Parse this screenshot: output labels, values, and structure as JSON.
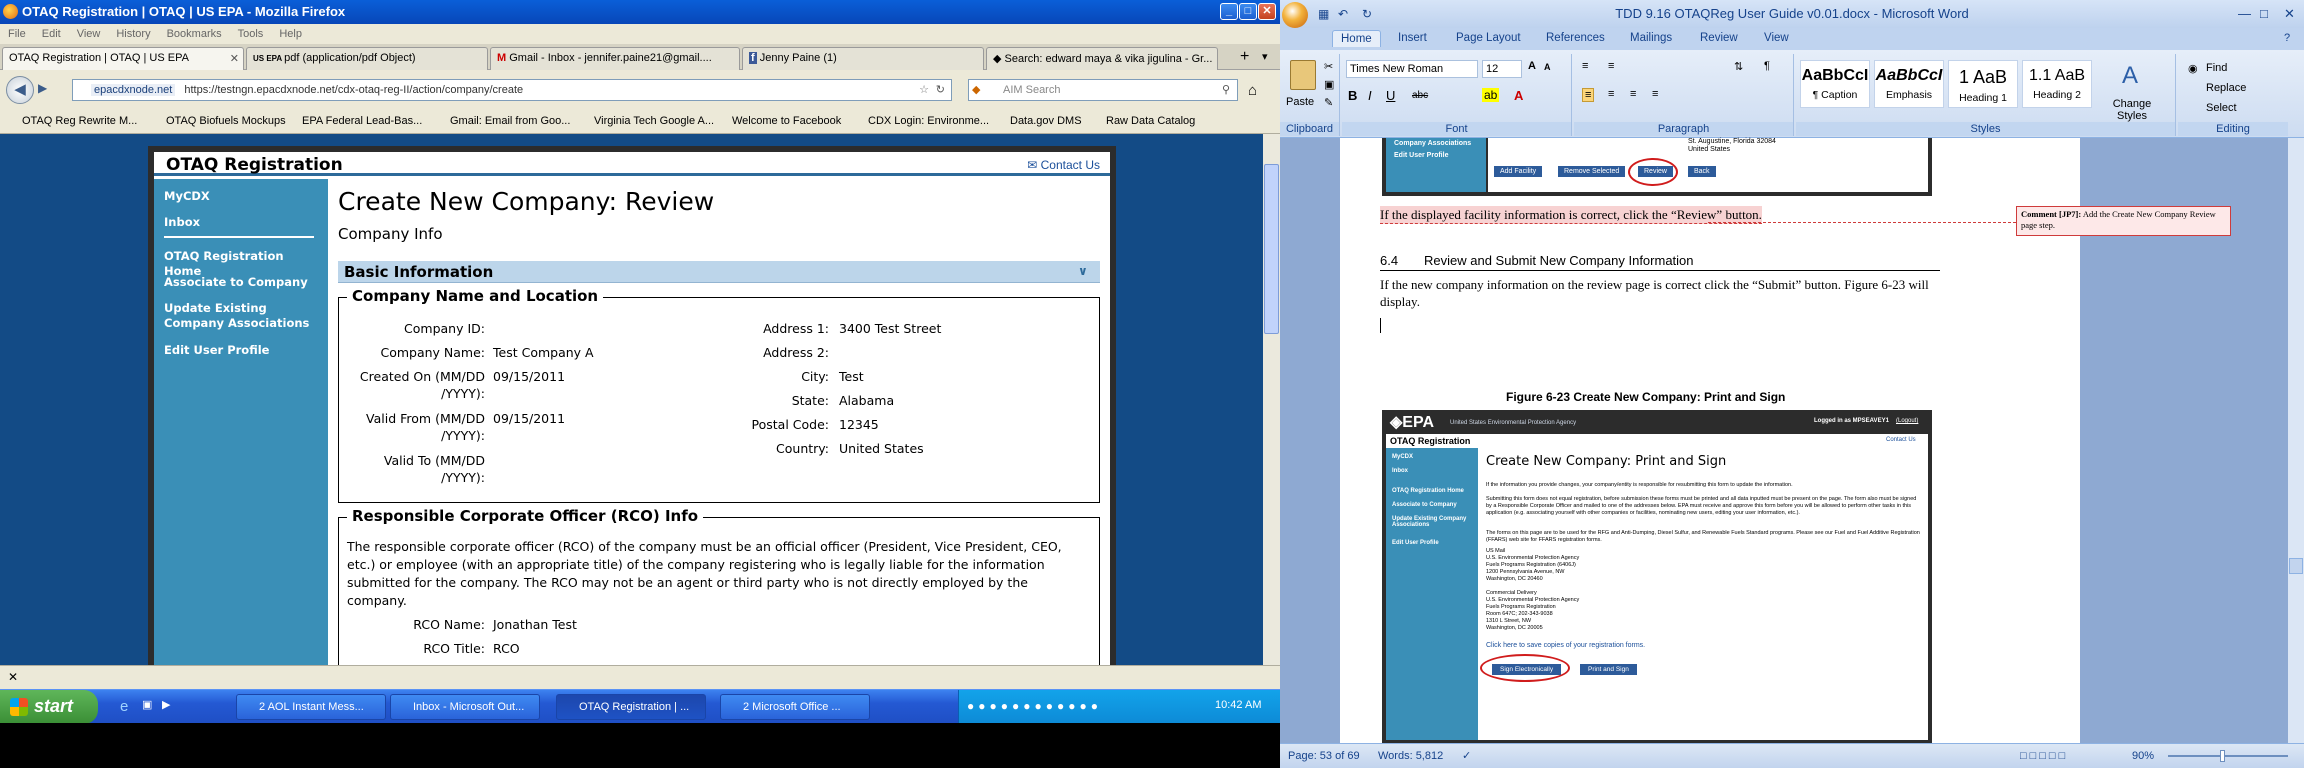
{
  "firefox": {
    "title": "OTAQ Registration | OTAQ | US EPA - Mozilla Firefox",
    "menu": [
      "File",
      "Edit",
      "View",
      "History",
      "Bookmarks",
      "Tools",
      "Help"
    ],
    "tabs": [
      {
        "label": "OTAQ Registration | OTAQ | US EPA"
      },
      {
        "label": "pdf (application/pdf Object)"
      },
      {
        "label": "Gmail - Inbox - jennifer.paine21@gmail...."
      },
      {
        "label": "Jenny Paine (1)"
      },
      {
        "label": "Search: edward maya & vika jigulina - Gr..."
      }
    ],
    "url_domain": "epacdxnode.net",
    "url": "https://testngn.epacdxnode.net/cdx-otaq-reg-II/action/company/create",
    "search_placeholder": "AIM Search",
    "bookmarks": [
      "OTAQ Reg Rewrite M...",
      "OTAQ Biofuels Mockups",
      "EPA Federal Lead-Bas...",
      "Gmail: Email from Goo...",
      "Virginia Tech Google A...",
      "Welcome to Facebook",
      "CDX Login: Environme...",
      "Data.gov DMS",
      "Raw Data Catalog"
    ]
  },
  "epa": {
    "header_title": "OTAQ Registration",
    "contact_us": "Contact Us",
    "nav": [
      "MyCDX",
      "Inbox",
      "OTAQ Registration Home",
      "Associate to Company",
      "Update Existing Company Associations",
      "Edit User Profile"
    ],
    "page_title": "Create New Company: Review",
    "subtitle": "Company Info",
    "section_bar": "Basic Information",
    "company_section": {
      "legend": "Company Name and Location",
      "left_labels": [
        "Company ID:",
        "Company Name:",
        "Created On (MM/DD /YYYY):",
        "Valid From (MM/DD /YYYY):",
        "Valid To (MM/DD /YYYY):"
      ],
      "left_values": [
        "",
        "Test Company A",
        "09/15/2011",
        "09/15/2011",
        ""
      ],
      "right_labels": [
        "Address 1:",
        "Address 2:",
        "City:",
        "State:",
        "Postal Code:",
        "Country:"
      ],
      "right_values": [
        "3400 Test Street",
        "",
        "Test",
        "Alabama",
        "12345",
        "United States"
      ]
    },
    "rco_section": {
      "legend": "Responsible Corporate Officer (RCO) Info",
      "description": "The responsible corporate officer (RCO) of the company must be an official officer (President, Vice President, CEO, etc.) or employee (with an appropriate title) of the company registering who is legally liable for the information submitted for the company. The RCO may not be an agent or third party who is not directly employed by the company.",
      "labels": [
        "RCO Name:",
        "RCO Title:"
      ],
      "values": [
        "Jonathan Test",
        "RCO"
      ]
    }
  },
  "taskbar": {
    "start": "start",
    "buttons": [
      "2 AOL Instant Mess...",
      "Inbox - Microsoft Out...",
      "OTAQ Registration | ...",
      "2 Microsoft Office ..."
    ],
    "clock": "10:42 AM"
  },
  "word": {
    "title": "TDD 9.16 OTAQReg User Guide v0.01.docx - Microsoft Word",
    "tabs": [
      "Home",
      "Insert",
      "Page Layout",
      "References",
      "Mailings",
      "Review",
      "View"
    ],
    "font_name": "Times New Roman",
    "font_size": "12",
    "groups": [
      "Clipboard",
      "Font",
      "Paragraph",
      "Styles",
      "Editing"
    ],
    "paste": "Paste",
    "styles": [
      {
        "preview": "AaBbCcI",
        "name": "¶ Caption"
      },
      {
        "preview": "AaBbCcI",
        "name": "Emphasis"
      },
      {
        "preview": "1 AaB",
        "name": "Heading 1"
      },
      {
        "preview": "1.1 AaB",
        "name": "Heading 2"
      }
    ],
    "change_styles": "Change Styles",
    "editing": [
      "Find",
      "Replace",
      "Select"
    ],
    "doc": {
      "top_nav": [
        "Company Associations",
        "Edit User Profile"
      ],
      "top_buttons": [
        "Add Facility",
        "Remove Selected",
        "Review",
        "Back"
      ],
      "top_address": [
        "St. Augustine, Florida 32084",
        "United States"
      ],
      "para1": "If the displayed facility information is correct, click the “Review” button.",
      "comment_label": "Comment [JP7]:",
      "comment_text": "Add the Create New Company Review page step.",
      "heading_num": "6.4",
      "heading": "Review and Submit New Company Information",
      "para2": "If the new company information on the review page is correct click the “Submit” button. Figure 6-23 will display.",
      "figure_caption": "Figure 6-23 Create New Company: Print and Sign",
      "shot": {
        "agency": "United States Environmental Protection Agency",
        "logged_in": "Logged in as MPSEAVEY1",
        "logout": "(Logout)",
        "header": "OTAQ Registration",
        "contact": "Contact Us",
        "nav": [
          "MyCDX",
          "Inbox",
          "OTAQ Registration Home",
          "Associate to Company",
          "Update Existing Company Associations",
          "Edit User Profile"
        ],
        "title": "Create New Company: Print and Sign",
        "p1": "If the information you provide changes, your company/entity is responsible for resubmitting this form to update the information.",
        "p2": "Submitting this form does not equal registration, before submission these forms must be printed and all data inputted must be present on the page. The form also must be signed by a Responsible Corporate Officer and mailed to one of the addresses below. EPA must receive and approve this form before you will be allowed to perform other tasks in this application (e.g. associating yourself with other companies or facilities, nominating new users, editing your user information, etc.).",
        "p3": "The forms on this page are to be used for the RFG and Anti-Dumping, Diesel Sulfur, and Renewable Fuels Standard programs. Please see our Fuel and Fuel Additive Registration (FFARS) web site for FFARS registration forms.",
        "mail": [
          "US Mail",
          "U.S. Environmental Protection Agency",
          "Fuels Programs Registration (6406J)",
          "1200 Pennsylvania Avenue, NW",
          "Washington, DC 20460"
        ],
        "courier": [
          "Commercial Delivery",
          "U.S. Environmental Protection Agency",
          "Fuels Programs Registration",
          "Room 647C; 202-343-9038",
          "1310 L Street, NW",
          "Washington, DC 20005"
        ],
        "save_link": "Click here to save copies of your registration forms.",
        "buttons": [
          "Sign Electronically",
          "Print and Sign"
        ]
      }
    },
    "status_page": "Page: 53 of 69",
    "status_words": "Words: 5,812",
    "zoom": "90%"
  }
}
